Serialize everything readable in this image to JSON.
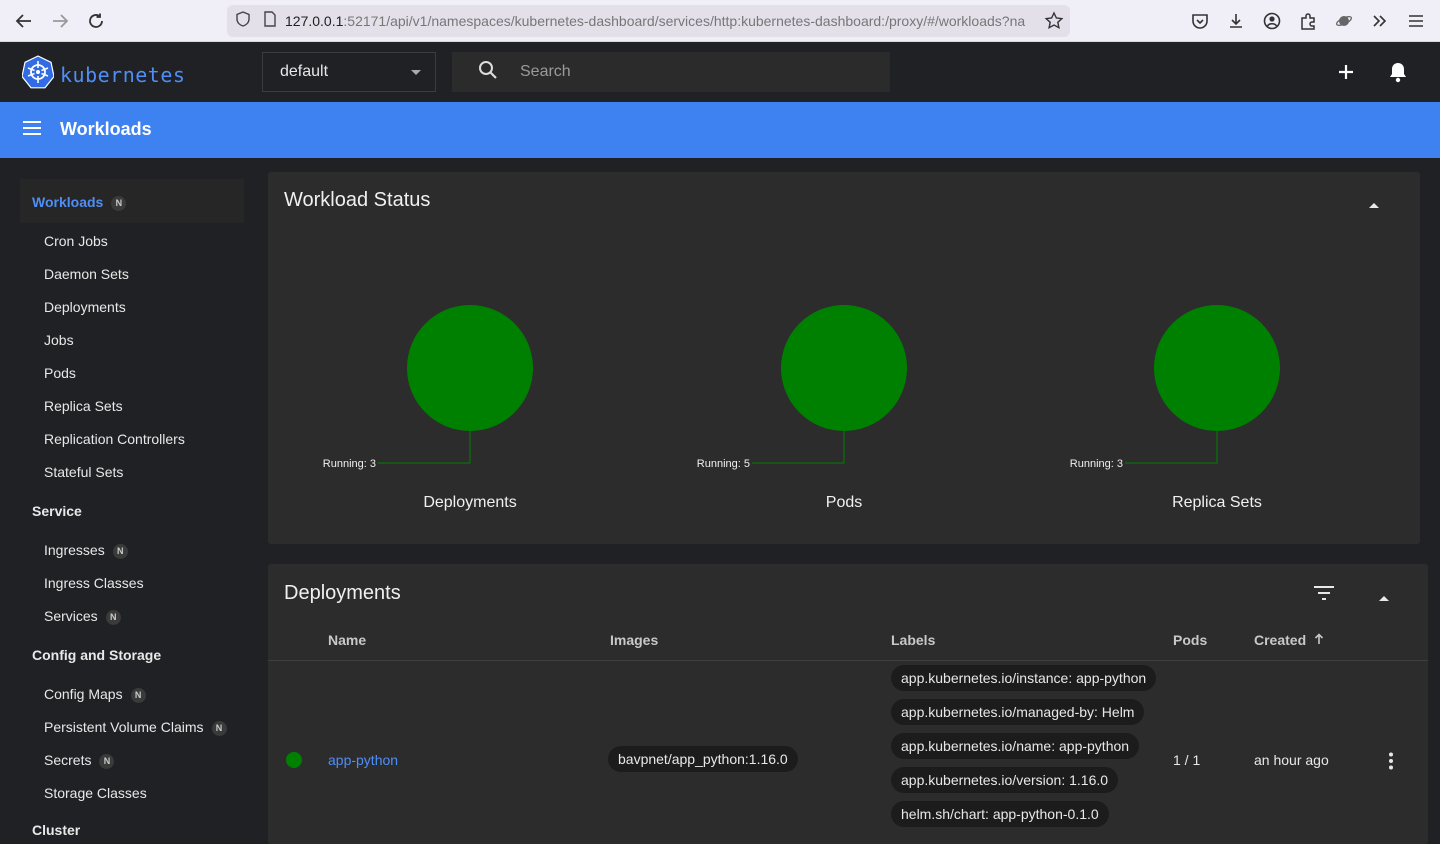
{
  "browser": {
    "url_host": "127.0.0.1",
    "url_rest": ":52171/api/v1/namespaces/kubernetes-dashboard/services/http:kubernetes-dashboard:/proxy/#/workloads?na"
  },
  "header": {
    "logo_text": "kubernetes",
    "namespace": "default",
    "search_placeholder": "Search"
  },
  "toolbar": {
    "title": "Workloads"
  },
  "sidebar": {
    "workloads": {
      "label": "Workloads",
      "badge": "N"
    },
    "workload_items": [
      "Cron Jobs",
      "Daemon Sets",
      "Deployments",
      "Jobs",
      "Pods",
      "Replica Sets",
      "Replication Controllers",
      "Stateful Sets"
    ],
    "service": {
      "label": "Service"
    },
    "service_items": [
      {
        "label": "Ingresses",
        "badge": "N"
      },
      {
        "label": "Ingress Classes",
        "badge": ""
      },
      {
        "label": "Services",
        "badge": "N"
      }
    ],
    "config": {
      "label": "Config and Storage"
    },
    "config_items": [
      {
        "label": "Config Maps",
        "badge": "N"
      },
      {
        "label": "Persistent Volume Claims",
        "badge": "N"
      },
      {
        "label": "Secrets",
        "badge": "N"
      },
      {
        "label": "Storage Classes",
        "badge": ""
      }
    ],
    "cluster": {
      "label": "Cluster"
    }
  },
  "workload_status": {
    "title": "Workload Status",
    "charts": [
      {
        "name": "Deployments",
        "running_label": "Running: 3"
      },
      {
        "name": "Pods",
        "running_label": "Running: 5"
      },
      {
        "name": "Replica Sets",
        "running_label": "Running: 3"
      }
    ],
    "running_color": "#008000"
  },
  "chart_data": [
    {
      "type": "pie",
      "title": "Deployments",
      "slices": [
        {
          "label": "Running",
          "value": 3
        }
      ]
    },
    {
      "type": "pie",
      "title": "Pods",
      "slices": [
        {
          "label": "Running",
          "value": 5
        }
      ]
    },
    {
      "type": "pie",
      "title": "Replica Sets",
      "slices": [
        {
          "label": "Running",
          "value": 3
        }
      ]
    }
  ],
  "deployments": {
    "title": "Deployments",
    "columns": {
      "name": "Name",
      "images": "Images",
      "labels": "Labels",
      "pods": "Pods",
      "created": "Created"
    },
    "rows": [
      {
        "status_color": "#008000",
        "name": "app-python",
        "image": "bavpnet/app_python:1.16.0",
        "labels": [
          "app.kubernetes.io/instance: app-python",
          "app.kubernetes.io/managed-by: Helm",
          "app.kubernetes.io/name: app-python",
          "app.kubernetes.io/version: 1.16.0",
          "helm.sh/chart: app-python-0.1.0"
        ],
        "pods": "1 / 1",
        "created": "an hour ago"
      }
    ]
  }
}
